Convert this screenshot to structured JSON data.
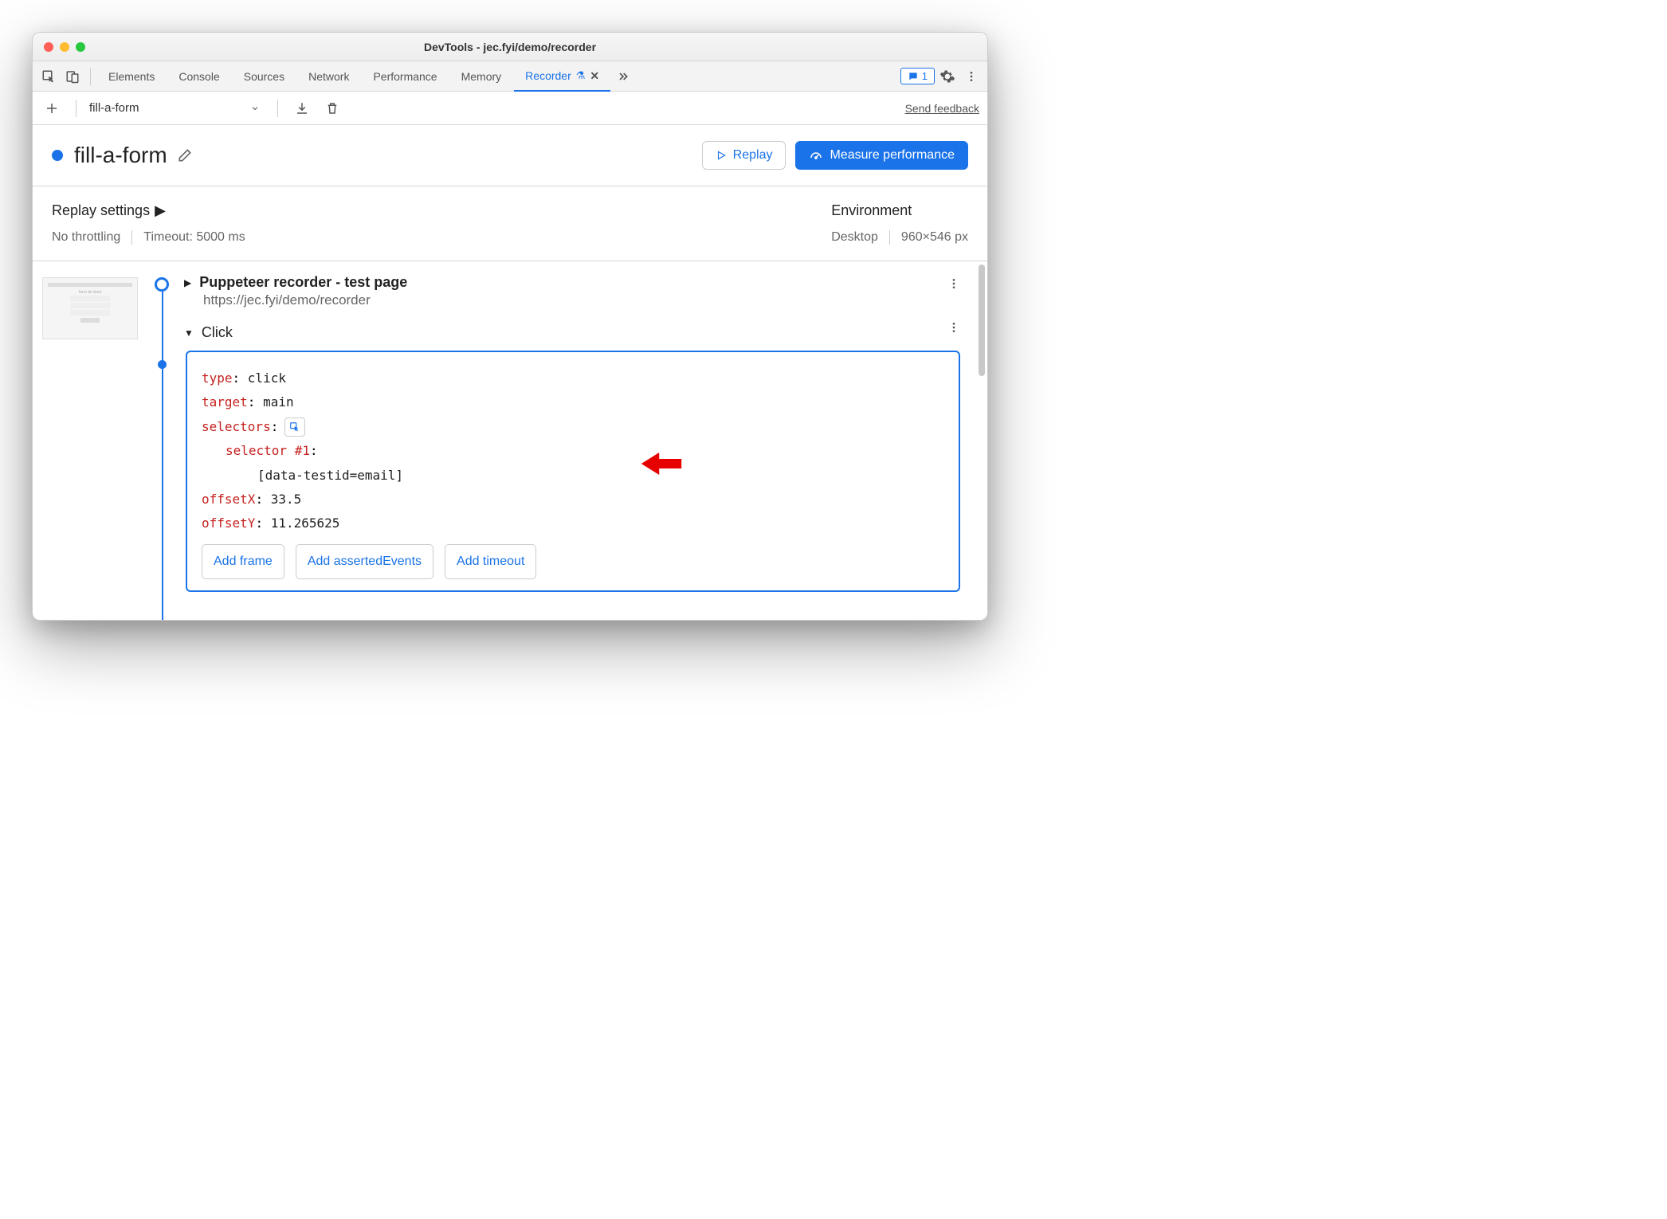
{
  "window": {
    "title": "DevTools - jec.fyi/demo/recorder"
  },
  "tabs": {
    "items": [
      "Elements",
      "Console",
      "Sources",
      "Network",
      "Performance",
      "Memory"
    ],
    "active": "Recorder",
    "badge_count": "1"
  },
  "toolbar": {
    "recording_name": "fill-a-form",
    "send_feedback": "Send feedback"
  },
  "header": {
    "title": "fill-a-form",
    "replay_label": "Replay",
    "measure_label": "Measure performance"
  },
  "settings": {
    "replay_title": "Replay settings",
    "throttling": "No throttling",
    "timeout": "Timeout: 5000 ms",
    "env_title": "Environment",
    "env_device": "Desktop",
    "env_size": "960×546 px"
  },
  "steps": {
    "step1": {
      "title": "Puppeteer recorder - test page",
      "url": "https://jec.fyi/demo/recorder"
    },
    "step2": {
      "title": "Click",
      "type_k": "type",
      "type_v": "click",
      "target_k": "target",
      "target_v": "main",
      "selectors_k": "selectors",
      "selector_label": "selector #1",
      "selector_value": "[data-testid=email]",
      "offsetx_k": "offsetX",
      "offsetx_v": "33.5",
      "offsety_k": "offsetY",
      "offsety_v": "11.265625",
      "add_frame": "Add frame",
      "add_asserted": "Add assertedEvents",
      "add_timeout": "Add timeout"
    }
  }
}
